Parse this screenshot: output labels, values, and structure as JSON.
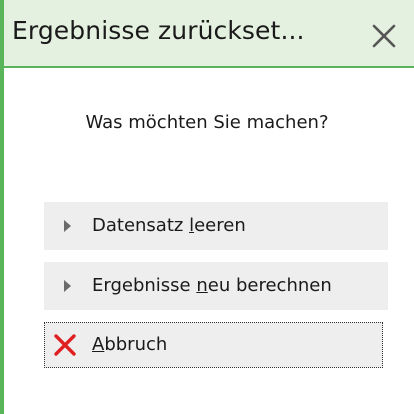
{
  "dialog": {
    "title": "Ergebnisse zurückset...",
    "close_icon": "close-icon",
    "question": "Was möchten Sie machen?",
    "options": [
      {
        "pre": "Datensatz ",
        "mnemonic": "l",
        "post": "eeren",
        "icon": "triangle-right-icon"
      },
      {
        "pre": "Ergebnisse ",
        "mnemonic": "n",
        "post": "eu berechnen",
        "icon": "triangle-right-icon"
      }
    ],
    "cancel": {
      "pre": "",
      "mnemonic": "A",
      "post": "bbruch",
      "icon": "red-x-icon"
    }
  },
  "colors": {
    "accent": "#5ab45a",
    "title_background": "#e5f1e0",
    "button_background": "#eeeeee",
    "cancel_icon": "#e02020"
  }
}
